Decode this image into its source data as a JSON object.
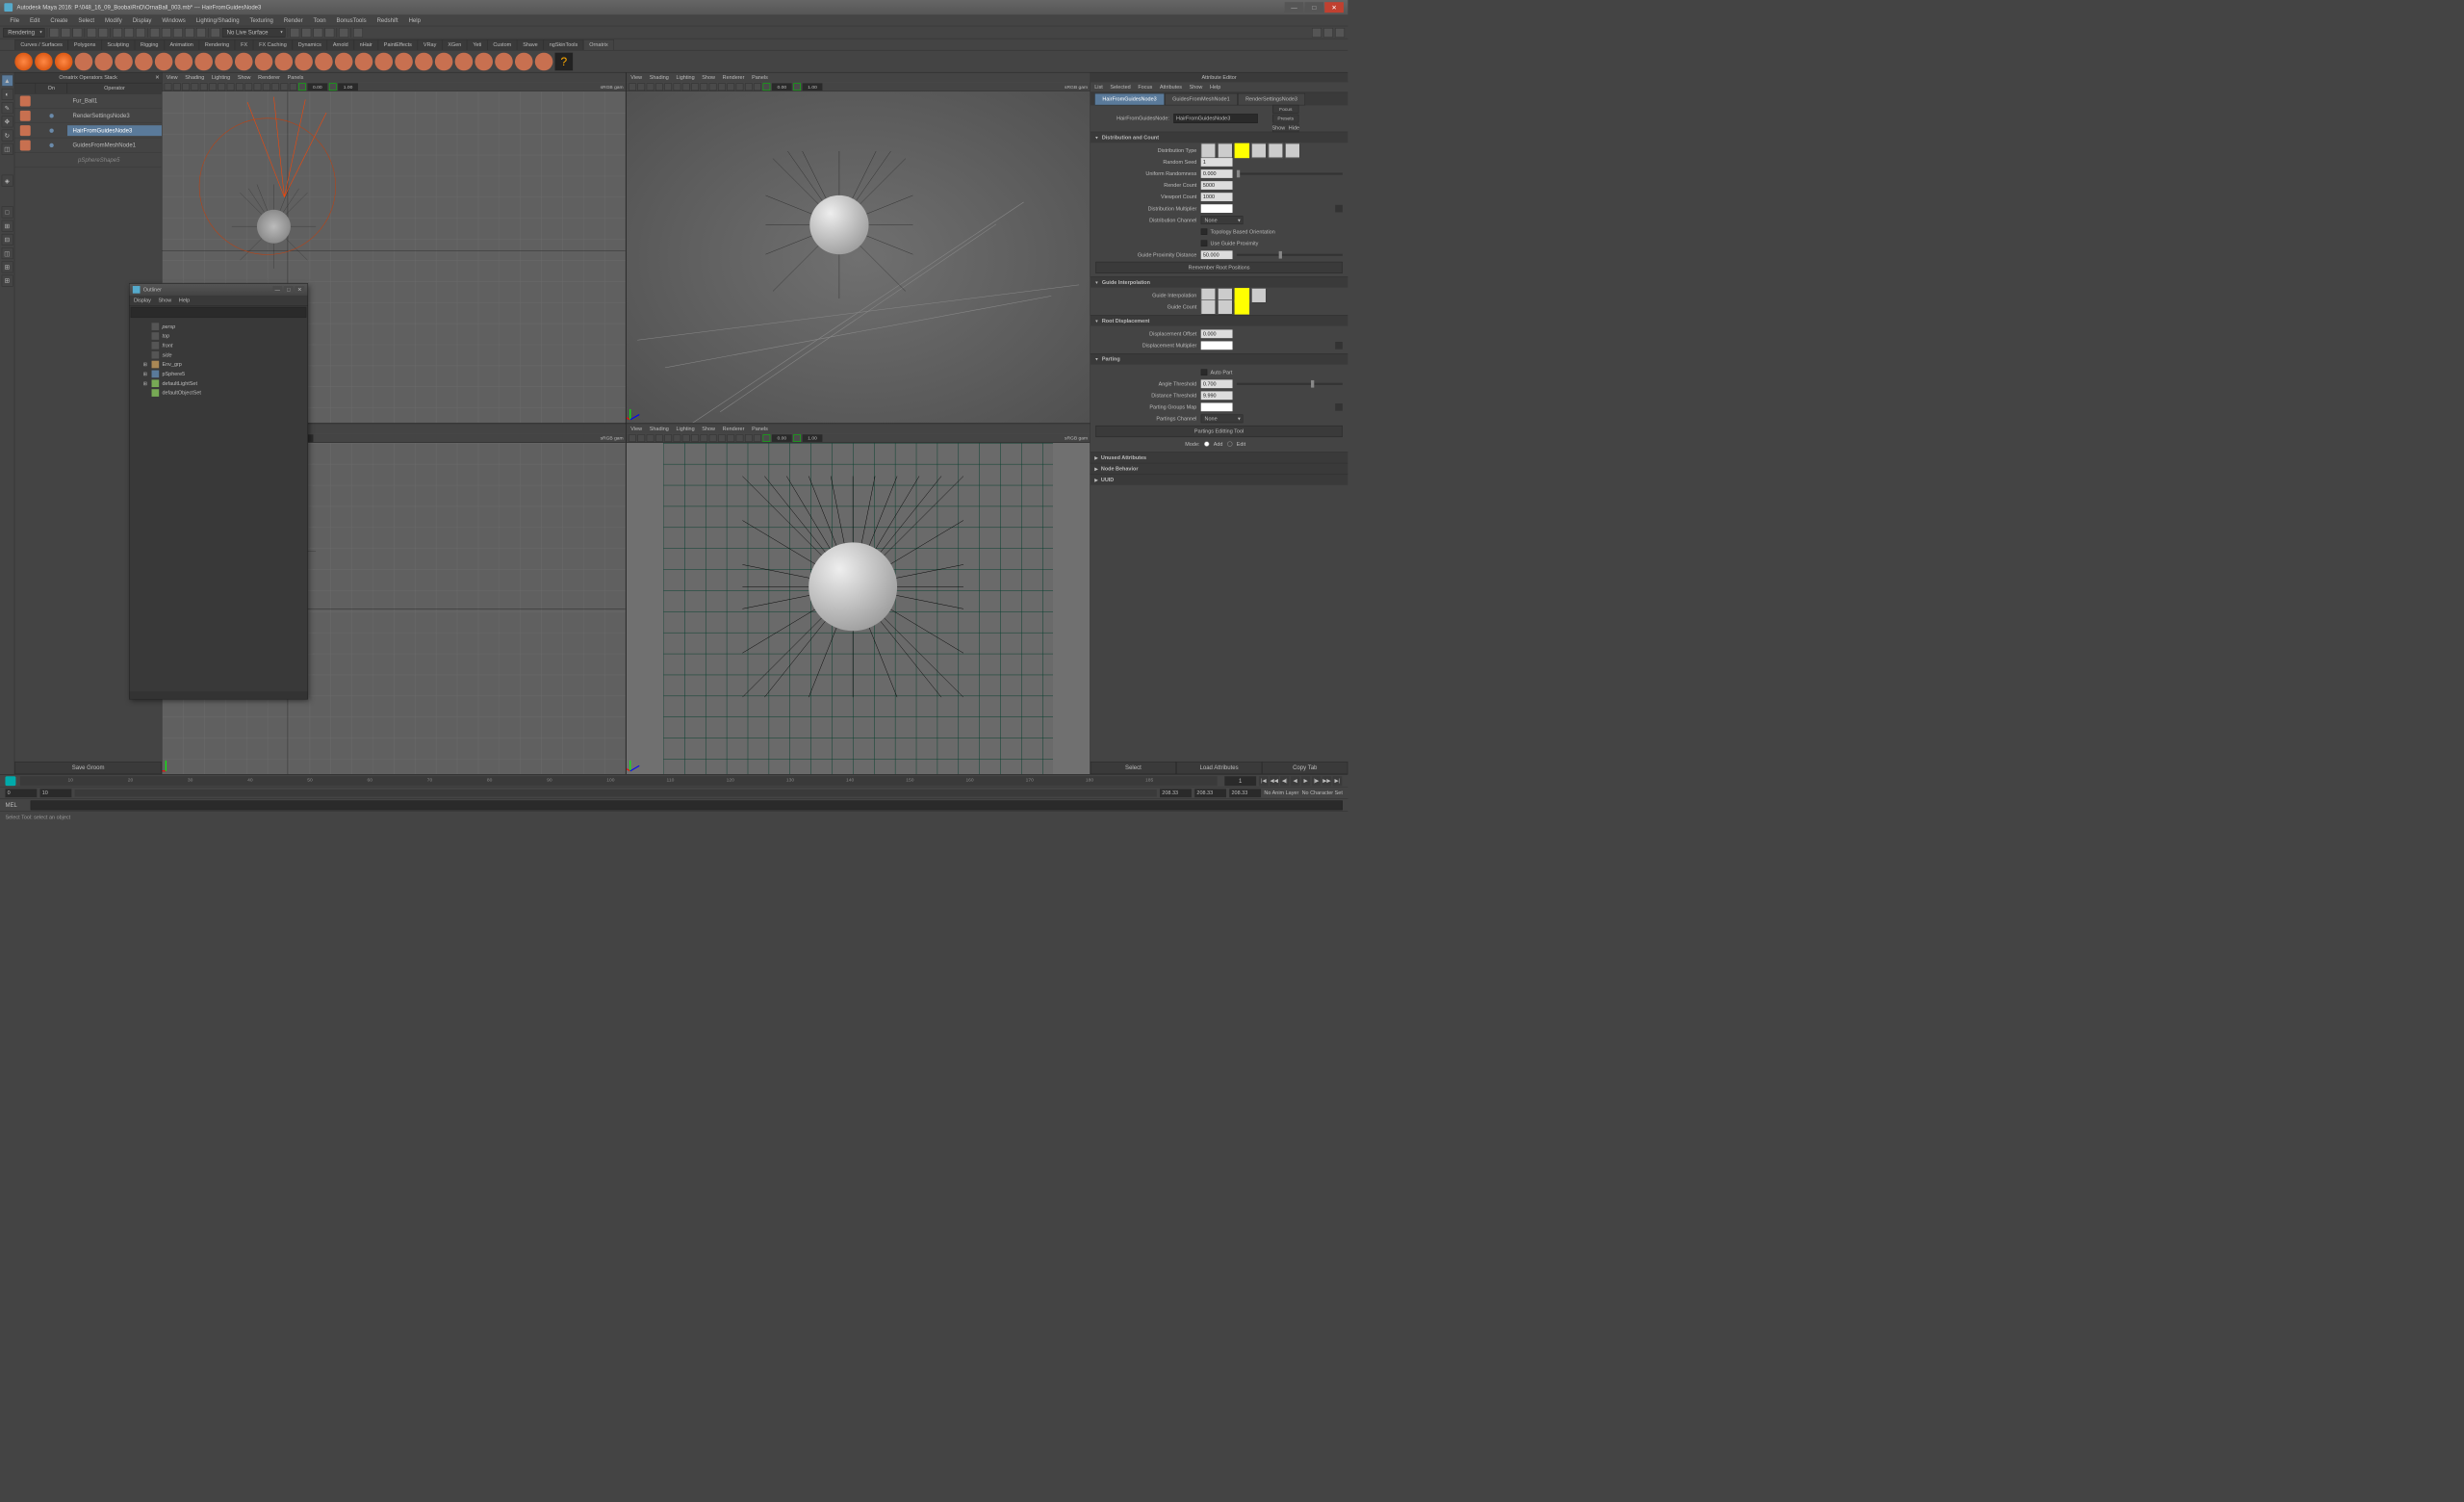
{
  "title": "Autodesk Maya 2016: P:\\048_16_09_Booba\\RnD\\OrnaBall_003.mb*  ---  HairFromGuidesNode3",
  "menubar": [
    "File",
    "Edit",
    "Create",
    "Select",
    "Modify",
    "Display",
    "Windows",
    "Lighting/Shading",
    "Texturing",
    "Render",
    "Toon",
    "BonusTools",
    "Redshift",
    "Help"
  ],
  "workspace_dd": "Rendering",
  "live_surface": "No Live Surface",
  "shelf_tabs": [
    "Curves / Surfaces",
    "Polygons",
    "Sculpting",
    "Rigging",
    "Animation",
    "Rendering",
    "FX",
    "FX Caching",
    "Dynamics",
    "Arnold",
    "nHair",
    "PaintEffects",
    "VRay",
    "XGen",
    "Yeti",
    "Custom",
    "Shave",
    "ngSkinTools",
    "Ornatrix"
  ],
  "ornatrix": {
    "header": "Ornatrix Operators Stack",
    "cols": {
      "c2": "On",
      "c3": "Operator"
    },
    "rows": [
      {
        "name": "Fur_Ball1"
      },
      {
        "name": "RenderSettingsNode3"
      },
      {
        "name": "HairFromGuidesNode3",
        "selected": true
      },
      {
        "name": "GuidesFromMeshNode1"
      },
      {
        "name": "pSphereShape5",
        "sub": true
      }
    ],
    "save": "Save Groom"
  },
  "vp_menu": [
    "View",
    "Shading",
    "Lighting",
    "Show",
    "Renderer",
    "Panels"
  ],
  "vp_panels_label": "Panels",
  "vp_gamma": "0.00",
  "vp_exposure": "1.00",
  "vp_colorspace": "sRGB gam",
  "attribute_editor": {
    "title": "Attribute Editor",
    "menu": [
      "List",
      "Selected",
      "Focus",
      "Attributes",
      "Show",
      "Help"
    ],
    "tabs": [
      "HairFromGuidesNode3",
      "GuidesFromMeshNode1",
      "RenderSettingsNode3"
    ],
    "node_label": "HairFromGuidesNode:",
    "node_value": "HairFromGuidesNode3",
    "focus": "Focus",
    "presets": "Presets",
    "show": "Show",
    "hide": "Hide",
    "sections": {
      "dist": {
        "title": "Distribution and Count",
        "dist_type": "Distribution Type",
        "random_seed": {
          "label": "Random Seed",
          "value": "1"
        },
        "uniform_randomness": {
          "label": "Uniform Randomness",
          "value": "0.000"
        },
        "render_count": {
          "label": "Render Count",
          "value": "5000"
        },
        "viewport_count": {
          "label": "Viewport Count",
          "value": "1000"
        },
        "dist_multiplier": "Distribution Multiplier",
        "dist_channel": {
          "label": "Distribution Channel",
          "value": "None"
        },
        "topo": "Topology Based Orientation",
        "guide_prox": "Use Guide Proximity",
        "guide_prox_dist": {
          "label": "Guide Proximity Distance",
          "value": "50.000"
        },
        "remember": "Remember Root Positions"
      },
      "interp": {
        "title": "Guide Interpolation",
        "guide_interp": "Guide Interpolation",
        "guide_count": "Guide Count"
      },
      "rootd": {
        "title": "Root Displacement",
        "offset": {
          "label": "Displacement Offset",
          "value": "0.000"
        },
        "mult": "Displacement Multiplier"
      },
      "parting": {
        "title": "Parting",
        "auto": "Auto Part",
        "angle": {
          "label": "Angle Threshold",
          "value": "0.700"
        },
        "dist": {
          "label": "Distance Threshold",
          "value": "9.990"
        },
        "groups": "Parting Groups Map",
        "channel": {
          "label": "Partings Channel",
          "value": "None"
        },
        "tool": "Partings Editting Tool",
        "mode": "Mode:",
        "add": "Add",
        "edit": "Edit"
      },
      "unused": "Unused Attributes",
      "nodebeh": "Node Behavior",
      "uuid": "UUID"
    },
    "footer": [
      "Select",
      "Load Attributes",
      "Copy Tab"
    ]
  },
  "outliner": {
    "title": "Outliner",
    "menu": [
      "Display",
      "Show",
      "Help"
    ],
    "nodes": [
      {
        "name": "persp",
        "dim": true
      },
      {
        "name": "top",
        "dim": true
      },
      {
        "name": "front",
        "dim": true
      },
      {
        "name": "side",
        "dim": true
      },
      {
        "name": "Env_grp",
        "exp": true
      },
      {
        "name": "pSphere5",
        "exp": true
      },
      {
        "name": "defaultLightSet",
        "exp": true
      },
      {
        "name": "defaultObjectSet"
      }
    ]
  },
  "timeline": {
    "frame": "1",
    "ticks": [
      "10",
      "20",
      "30",
      "40",
      "50",
      "60",
      "70",
      "80",
      "90",
      "100",
      "110",
      "120",
      "130",
      "140",
      "150",
      "160",
      "170",
      "180",
      "185"
    ]
  },
  "range": {
    "start": "0",
    "end": "10"
  },
  "status": {
    "v1": "208.33",
    "v2": "208.33",
    "v3": "208.33",
    "anim": "No Anim Layer",
    "char": "No Character Set"
  },
  "cmd": "MEL",
  "help": "Select Tool: select an object"
}
